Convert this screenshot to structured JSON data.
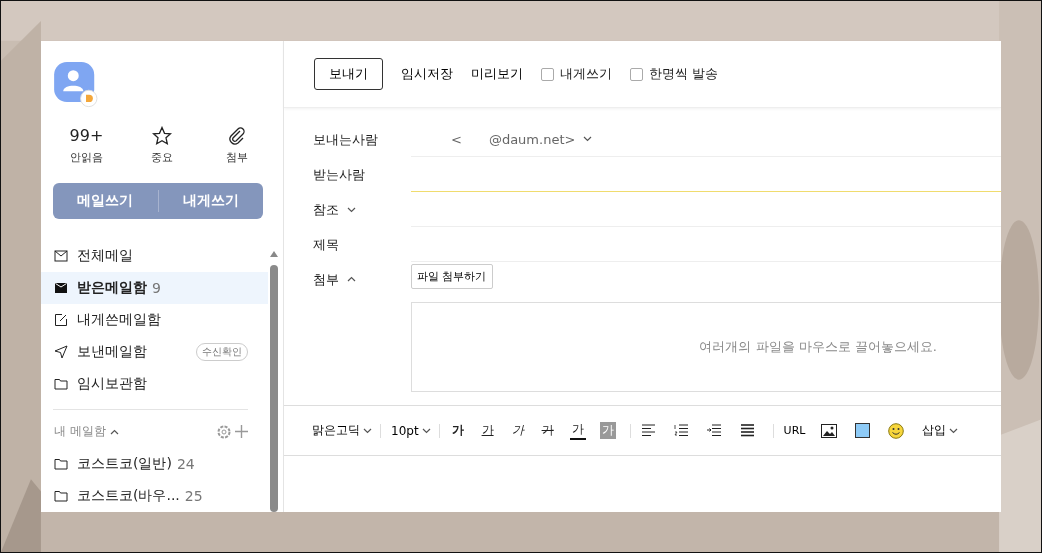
{
  "profile": {
    "stats": [
      {
        "kind": "count",
        "value": "99+",
        "label": "안읽음"
      },
      {
        "kind": "star",
        "label": "중요"
      },
      {
        "kind": "clip",
        "label": "첨부"
      }
    ]
  },
  "compose_buttons": [
    "메일쓰기",
    "내게쓰기"
  ],
  "folders": [
    {
      "kind": "mail",
      "label": "전체메일",
      "selected": false
    },
    {
      "kind": "inbox",
      "label": "받은메일함",
      "count": "9",
      "selected": true
    },
    {
      "kind": "note",
      "label": "내게쓴메일함",
      "selected": false
    },
    {
      "kind": "send",
      "label": "보낸메일함",
      "badge": "수신확인",
      "selected": false
    },
    {
      "kind": "folder",
      "label": "임시보관함",
      "selected": false
    }
  ],
  "my_mailbox": {
    "title": "내 메일함",
    "expanded": true,
    "items": [
      {
        "label": "코스트코(일반)",
        "count": "24"
      },
      {
        "label": "코스트코(바우...",
        "count": "25"
      }
    ]
  },
  "toolbar": {
    "send": "보내기",
    "actions": [
      "임시저장",
      "미리보기"
    ],
    "checkboxes": [
      {
        "label": "내게쓰기",
        "checked": false
      },
      {
        "label": "한명씩 발송",
        "checked": false
      }
    ]
  },
  "form": {
    "sender_label": "보내는사람",
    "sender_open": "<",
    "sender_domain": "@daum.net>",
    "to_label": "받는사람",
    "cc_label": "참조",
    "cc_expanded": false,
    "subject_label": "제목",
    "attach_label": "첨부",
    "attach_expanded": true,
    "attach_button": "파일 첨부하기",
    "drop_hint": "여러개의 파일을 마우스로 끌어놓으세요."
  },
  "editor_toolbar": {
    "font": "맑은고딕",
    "size": "10pt",
    "styles": [
      {
        "kind": "bold",
        "label": "가"
      },
      {
        "kind": "underline",
        "label": "가"
      },
      {
        "kind": "italic",
        "label": "가"
      },
      {
        "kind": "strike",
        "label": "가"
      },
      {
        "kind": "textcolor",
        "label": "가"
      },
      {
        "kind": "bgcolor",
        "label": "가"
      }
    ],
    "link": "URL",
    "insert": "삽입"
  }
}
